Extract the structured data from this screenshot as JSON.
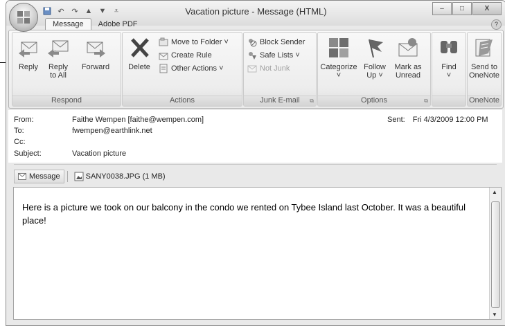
{
  "window": {
    "title": "Vacation picture - Message (HTML)",
    "controls": {
      "minimize": "–",
      "maximize": "□",
      "close": "X"
    }
  },
  "tabs": [
    {
      "label": "Message",
      "active": true
    },
    {
      "label": "Adobe PDF",
      "active": false
    }
  ],
  "ribbon": {
    "respond": {
      "label": "Respond",
      "reply": "Reply",
      "reply_all_1": "Reply",
      "reply_all_2": "to All",
      "forward": "Forward"
    },
    "actions": {
      "label": "Actions",
      "delete": "Delete",
      "move_to_folder": "Move to Folder ˅",
      "create_rule": "Create Rule",
      "other_actions": "Other Actions ˅"
    },
    "junk": {
      "label": "Junk E-mail",
      "block_sender": "Block Sender",
      "safe_lists": "Safe Lists ˅",
      "not_junk": "Not Junk"
    },
    "options": {
      "label": "Options",
      "categorize": "Categorize",
      "follow_up_1": "Follow",
      "follow_up_2": "Up ˅",
      "mark_as_unread_1": "Mark as",
      "mark_as_unread_2": "Unread"
    },
    "find": {
      "label": "Find"
    },
    "onenote": {
      "label": "OneNote",
      "send_1": "Send to",
      "send_2": "OneNote"
    }
  },
  "header": {
    "from_label": "From:",
    "from_value": "Faithe Wempen [faithe@wempen.com]",
    "to_label": "To:",
    "to_value": "fwempen@earthlink.net",
    "cc_label": "Cc:",
    "cc_value": "",
    "subject_label": "Subject:",
    "subject_value": "Vacation picture",
    "sent_label": "Sent:",
    "sent_value": "Fri 4/3/2009 12:00 PM"
  },
  "attachments": {
    "message_label": "Message",
    "file": "SANY0038.JPG (1 MB)"
  },
  "body": {
    "text": "Here is a picture we took on our balcony in the condo we rented on Tybee Island last October. It was a beautiful place!"
  }
}
